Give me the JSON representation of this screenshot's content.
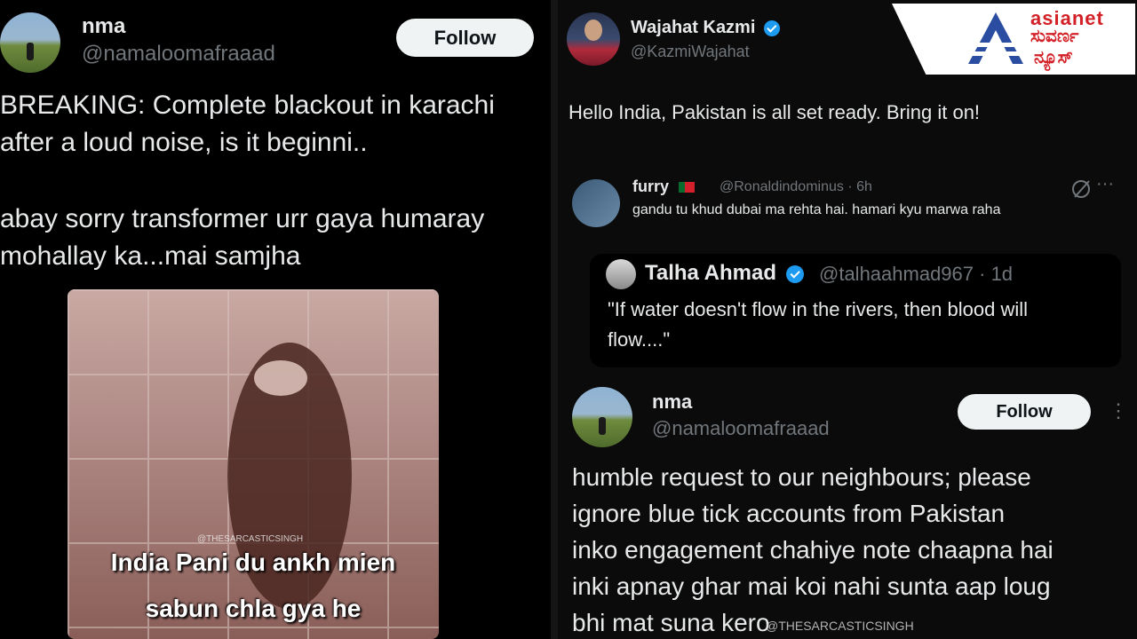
{
  "left_tweet": {
    "name": "nma",
    "handle": "@namaloomafraaad",
    "follow_label": "Follow",
    "text_line1": "BREAKING: Complete blackout in karachi",
    "text_line2": "after a loud noise, is it beginni..",
    "text_line3": "abay sorry transformer urr gaya humaray",
    "text_line4": "mohallay ka...mai samjha",
    "meme": {
      "watermark": "@THESARCASTICSINGH",
      "caption_line1": "India Pani du ankh mien",
      "caption_line2": "sabun chla gya he"
    }
  },
  "right_tweet": {
    "name": "Wajahat Kazmi",
    "handle": "@KazmiWajahat",
    "text": "Hello India, Pakistan is all set ready. Bring it on!"
  },
  "reply": {
    "name": "furry",
    "handle_time": "@Ronaldindominus · 6h",
    "text": "gandu tu khud dubai ma rehta hai. hamari kyu marwa raha",
    "more": "···"
  },
  "quote": {
    "name": "Talha Ahmad",
    "handle_time": "@talhaahmad967 · 1d",
    "text_line1": "\"If water doesn't flow in the rivers, then blood will",
    "text_line2": "flow....\""
  },
  "right_tweet2": {
    "name": "nma",
    "handle": "@namaloomafraaad",
    "follow_label": "Follow",
    "more": "⋮",
    "text_line1": "humble request to our neighbours; please",
    "text_line2": "ignore blue tick accounts from Pakistan",
    "text_line3": "inko engagement chahiye note chaapna hai",
    "text_line4": "inki apnay ghar mai koi nahi sunta aap loug",
    "text_line5": "bhi mat suna kero",
    "watermark": "@THESARCASTICSINGH"
  },
  "logo": {
    "line1": "asianet",
    "line2": "ಸುವರ್ಣ",
    "line3": "ನ್ಯೂಸ್"
  },
  "colors": {
    "verified": "#1d9bf0",
    "logo_red": "#d32027",
    "logo_blue": "#2a4da1"
  }
}
